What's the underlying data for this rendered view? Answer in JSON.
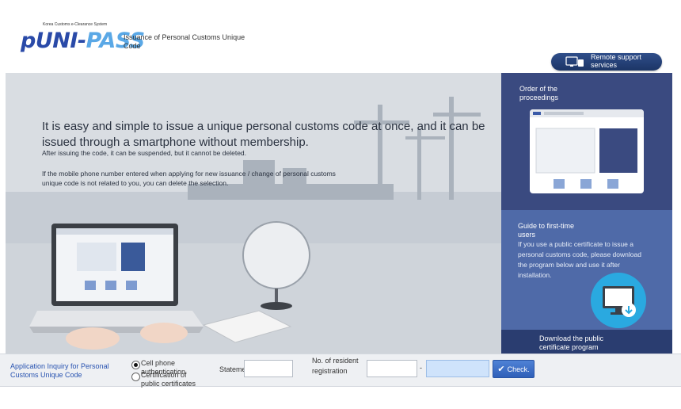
{
  "header": {
    "logo_tagline": "Korea Customs e-Clearance System",
    "logo_word_a": "pUNI-",
    "logo_word_b": "PASS",
    "page_title": "Issuance of Personal Customs Unique Code",
    "remote_support": "Remote support services"
  },
  "hero": {
    "headline": "It is easy and simple to issue a unique personal customs code at once, and it can be issued through a smartphone without membership.",
    "note_suspend": "After issuing the code, it can be suspended, but it cannot be deleted.",
    "note_delete": "If the mobile phone number entered when applying for new issuance / change of personal customs unique code is not related to you, you can delete the selection."
  },
  "side": {
    "order_title": "Order of the proceedings",
    "guide_title": "Guide to first-time users",
    "guide_text": "If you use a public certificate to issue a personal customs code, please download the program below and use it after installation.",
    "download_title": "Download the public certificate program"
  },
  "inquiry": {
    "app_label": "Application Inquiry for Personal Customs Unique Code",
    "radio_cell": "Cell phone authentication",
    "radio_cert": "Certification of public certificates",
    "radio_selected": "cell",
    "statement_label": "Statement",
    "statement_value": "",
    "resident_label": "No. of resident registration",
    "resident_dash": "-",
    "resident_part1": "",
    "resident_part2": "",
    "check_label": "Check."
  },
  "colors": {
    "brand_blue": "#2a4aa8",
    "accent_light": "#5aa8e6",
    "panel_order": "#3a4a80",
    "panel_guide": "#4f6aa8",
    "panel_download": "#2a3d70",
    "link_blue": "#2752b0",
    "check_button": "#2f5fb8"
  },
  "icons": {
    "remote": "monitor-icon",
    "guide": "download-monitor-icon",
    "check": "checkmark-icon"
  }
}
